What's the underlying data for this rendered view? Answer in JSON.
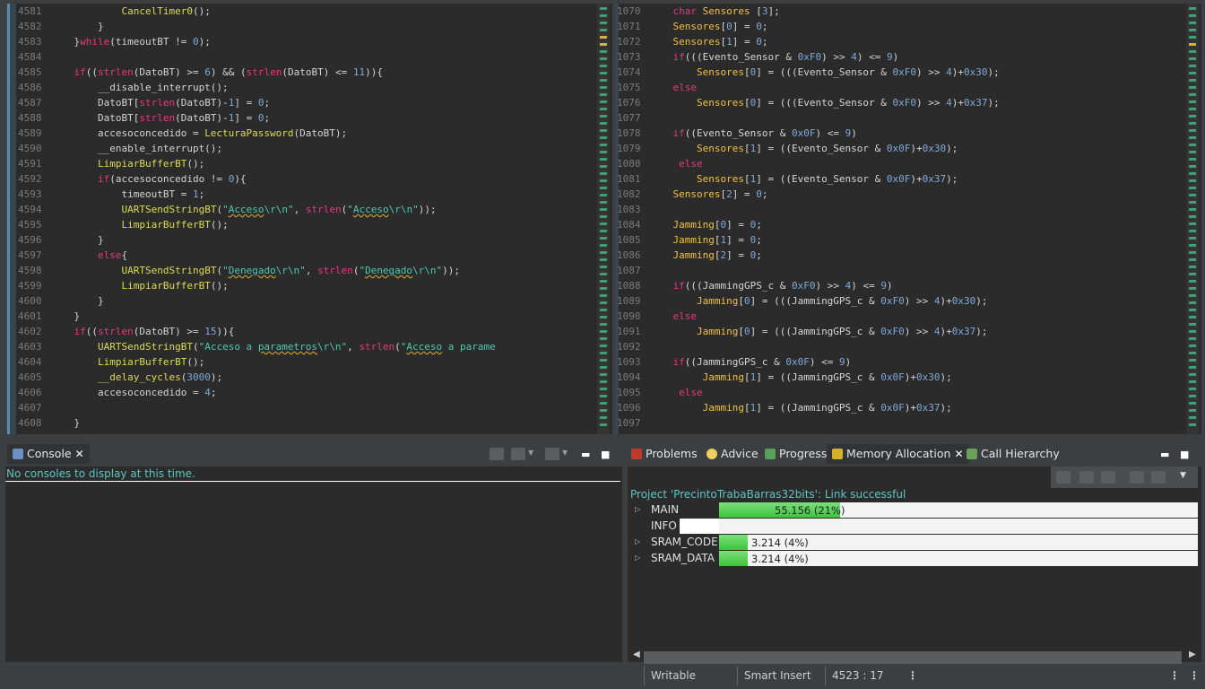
{
  "left_editor": {
    "lines": [
      {
        "n": "4581",
        "html": "            <span class=\"fnb\">CancelTimer0</span>();"
      },
      {
        "n": "4582",
        "html": "        }"
      },
      {
        "n": "4583",
        "html": "    }<span class=\"kw\">while</span>(timeoutBT != <span class=\"num\">0</span>);"
      },
      {
        "n": "4584",
        "html": ""
      },
      {
        "n": "4585",
        "html": "    <span class=\"kw\">if</span>((<span class=\"kw\">strlen</span>(DatoBT) >= <span class=\"num\">6</span>) && (<span class=\"kw\">strlen</span>(DatoBT) <= <span class=\"num\">11</span>)){"
      },
      {
        "n": "4586",
        "html": "        __disable_interrupt();"
      },
      {
        "n": "4587",
        "html": "        DatoBT[<span class=\"kw\">strlen</span>(DatoBT)-<span class=\"num\">1</span>] = <span class=\"num\">0</span>;"
      },
      {
        "n": "4588",
        "html": "        DatoBT[<span class=\"kw\">strlen</span>(DatoBT)-<span class=\"num\">1</span>] = <span class=\"num\">0</span>;"
      },
      {
        "n": "4589",
        "html": "        accesoconcedido = <span class=\"fnb\">LecturaPassword</span>(DatoBT);"
      },
      {
        "n": "4590",
        "html": "        __enable_interrupt();"
      },
      {
        "n": "4591",
        "html": "        <span class=\"fnb\">LimpiarBufferBT</span>();"
      },
      {
        "n": "4592",
        "html": "        <span class=\"kw\">if</span>(accesoconcedido != <span class=\"num\">0</span>){"
      },
      {
        "n": "4593",
        "html": "            timeoutBT = <span class=\"num\">1</span>;"
      },
      {
        "n": "4594",
        "html": "            <span class=\"fnb\">UARTSendStringBT</span>(<span class=\"str\">\"<span class=\"sq\">Acceso</span>\\r\\n\"</span>, <span class=\"kw\">strlen</span>(<span class=\"str\">\"<span class=\"sq\">Acceso</span>\\r\\n\"</span>));"
      },
      {
        "n": "4595",
        "html": "            <span class=\"fnb\">LimpiarBufferBT</span>();"
      },
      {
        "n": "4596",
        "html": "        }"
      },
      {
        "n": "4597",
        "html": "        <span class=\"kw\">else</span>{"
      },
      {
        "n": "4598",
        "html": "            <span class=\"fnb\">UARTSendStringBT</span>(<span class=\"str\">\"<span class=\"sq\">Denegado</span>\\r\\n\"</span>, <span class=\"kw\">strlen</span>(<span class=\"str\">\"<span class=\"sq\">Denegado</span>\\r\\n\"</span>));"
      },
      {
        "n": "4599",
        "html": "            <span class=\"fnb\">LimpiarBufferBT</span>();"
      },
      {
        "n": "4600",
        "html": "        }"
      },
      {
        "n": "4601",
        "html": "    }"
      },
      {
        "n": "4602",
        "html": "    <span class=\"kw\">if</span>((<span class=\"kw\">strlen</span>(DatoBT) >= <span class=\"num\">15</span>)){"
      },
      {
        "n": "4603",
        "html": "        <span class=\"fnb\">UARTSendStringBT</span>(<span class=\"str\">\"Acceso a <span class=\"sq\">parametros</span>\\r\\n\"</span>, <span class=\"kw\">strlen</span>(<span class=\"str\">\"<span class=\"sq\">Acceso</span> a parame</span>"
      },
      {
        "n": "4604",
        "html": "        <span class=\"fnb\">LimpiarBufferBT</span>();"
      },
      {
        "n": "4605",
        "html": "        <span class=\"fnb\">__delay_cycles</span>(<span class=\"num\">3000</span>);"
      },
      {
        "n": "4606",
        "html": "        accesoconcedido = <span class=\"num\">4</span>;"
      },
      {
        "n": "4607",
        "html": ""
      },
      {
        "n": "4608",
        "html": "    }"
      }
    ]
  },
  "right_editor": {
    "lines": [
      {
        "n": "1070",
        "html": "    <span class=\"kw\">char</span> <span class=\"fn\">Sensores</span> [<span class=\"num\">3</span>];"
      },
      {
        "n": "1071",
        "html": "    <span class=\"fn\">Sensores</span>[<span class=\"num\">0</span>] = <span class=\"num\">0</span>;"
      },
      {
        "n": "1072",
        "html": "    <span class=\"fn\">Sensores</span>[<span class=\"num\">1</span>] = <span class=\"num\">0</span>;"
      },
      {
        "n": "1073",
        "html": "    <span class=\"kw\">if</span>(((Evento_Sensor & <span class=\"num\">0xF0</span>) >> <span class=\"num\">4</span>) <= <span class=\"num\">9</span>)"
      },
      {
        "n": "1074",
        "html": "        <span class=\"fn\">Sensores</span>[<span class=\"num\">0</span>] = (((Evento_Sensor & <span class=\"num\">0xF0</span>) >> <span class=\"num\">4</span>)+<span class=\"num\">0x30</span>);"
      },
      {
        "n": "1075",
        "html": "    <span class=\"kw\">else</span>"
      },
      {
        "n": "1076",
        "html": "        <span class=\"fn\">Sensores</span>[<span class=\"num\">0</span>] = (((Evento_Sensor & <span class=\"num\">0xF0</span>) >> <span class=\"num\">4</span>)+<span class=\"num\">0x37</span>);"
      },
      {
        "n": "1077",
        "html": ""
      },
      {
        "n": "1078",
        "html": "    <span class=\"kw\">if</span>((Evento_Sensor & <span class=\"num\">0x0F</span>) <= <span class=\"num\">9</span>)"
      },
      {
        "n": "1079",
        "html": "        <span class=\"fn\">Sensores</span>[<span class=\"num\">1</span>] = ((Evento_Sensor & <span class=\"num\">0x0F</span>)+<span class=\"num\">0x30</span>);"
      },
      {
        "n": "1080",
        "html": "     <span class=\"kw\">else</span>"
      },
      {
        "n": "1081",
        "html": "        <span class=\"fn\">Sensores</span>[<span class=\"num\">1</span>] = ((Evento_Sensor & <span class=\"num\">0x0F</span>)+<span class=\"num\">0x37</span>);"
      },
      {
        "n": "1082",
        "html": "    <span class=\"fn\">Sensores</span>[<span class=\"num\">2</span>] = <span class=\"num\">0</span>;"
      },
      {
        "n": "1083",
        "html": ""
      },
      {
        "n": "1084",
        "html": "    <span class=\"fn\">Jamming</span>[<span class=\"num\">0</span>] = <span class=\"num\">0</span>;"
      },
      {
        "n": "1085",
        "html": "    <span class=\"fn\">Jamming</span>[<span class=\"num\">1</span>] = <span class=\"num\">0</span>;"
      },
      {
        "n": "1086",
        "html": "    <span class=\"fn\">Jamming</span>[<span class=\"num\">2</span>] = <span class=\"num\">0</span>;"
      },
      {
        "n": "1087",
        "html": ""
      },
      {
        "n": "1088",
        "html": "    <span class=\"kw\">if</span>(((JammingGPS_c & <span class=\"num\">0xF0</span>) >> <span class=\"num\">4</span>) <= <span class=\"num\">9</span>)"
      },
      {
        "n": "1089",
        "html": "        <span class=\"fn\">Jamming</span>[<span class=\"num\">0</span>] = (((JammingGPS_c & <span class=\"num\">0xF0</span>) >> <span class=\"num\">4</span>)+<span class=\"num\">0x30</span>);"
      },
      {
        "n": "1090",
        "html": "    <span class=\"kw\">else</span>"
      },
      {
        "n": "1091",
        "html": "        <span class=\"fn\">Jamming</span>[<span class=\"num\">0</span>] = (((JammingGPS_c & <span class=\"num\">0xF0</span>) >> <span class=\"num\">4</span>)+<span class=\"num\">0x37</span>);"
      },
      {
        "n": "1092",
        "html": ""
      },
      {
        "n": "1093",
        "html": "    <span class=\"kw\">if</span>((JammingGPS_c & <span class=\"num\">0x0F</span>) <= <span class=\"num\">9</span>)"
      },
      {
        "n": "1094",
        "html": "         <span class=\"fn\">Jamming</span>[<span class=\"num\">1</span>] = ((JammingGPS_c & <span class=\"num\">0x0F</span>)+<span class=\"num\">0x30</span>);"
      },
      {
        "n": "1095",
        "html": "     <span class=\"kw\">else</span>"
      },
      {
        "n": "1096",
        "html": "         <span class=\"fn\">Jamming</span>[<span class=\"num\">1</span>] = ((JammingGPS_c & <span class=\"num\">0x0F</span>)+<span class=\"num\">0x37</span>);"
      },
      {
        "n": "1097",
        "html": ""
      }
    ]
  },
  "console": {
    "tab_label": "Console",
    "message": "No consoles to display at this time."
  },
  "bottom_right": {
    "tabs": [
      "Problems",
      "Advice",
      "Progress",
      "Memory Allocation",
      "Call Hierarchy"
    ],
    "link_status": "Project 'PrecintoTrabaBarras32bits': Link successful",
    "memory": [
      {
        "name": "MAIN",
        "value": "55.156 (21%)",
        "percent": 21,
        "expandable": true
      },
      {
        "name": "INFO",
        "value": "",
        "percent": 0,
        "expandable": false
      },
      {
        "name": "SRAM_CODE",
        "value": "3.214 (4%)",
        "percent": 4,
        "expandable": true
      },
      {
        "name": "SRAM_DATA",
        "value": "3.214 (4%)",
        "percent": 4,
        "expandable": true
      }
    ]
  },
  "status_bar": {
    "writable": "Writable",
    "insert_mode": "Smart Insert",
    "position": "4523 : 17"
  }
}
